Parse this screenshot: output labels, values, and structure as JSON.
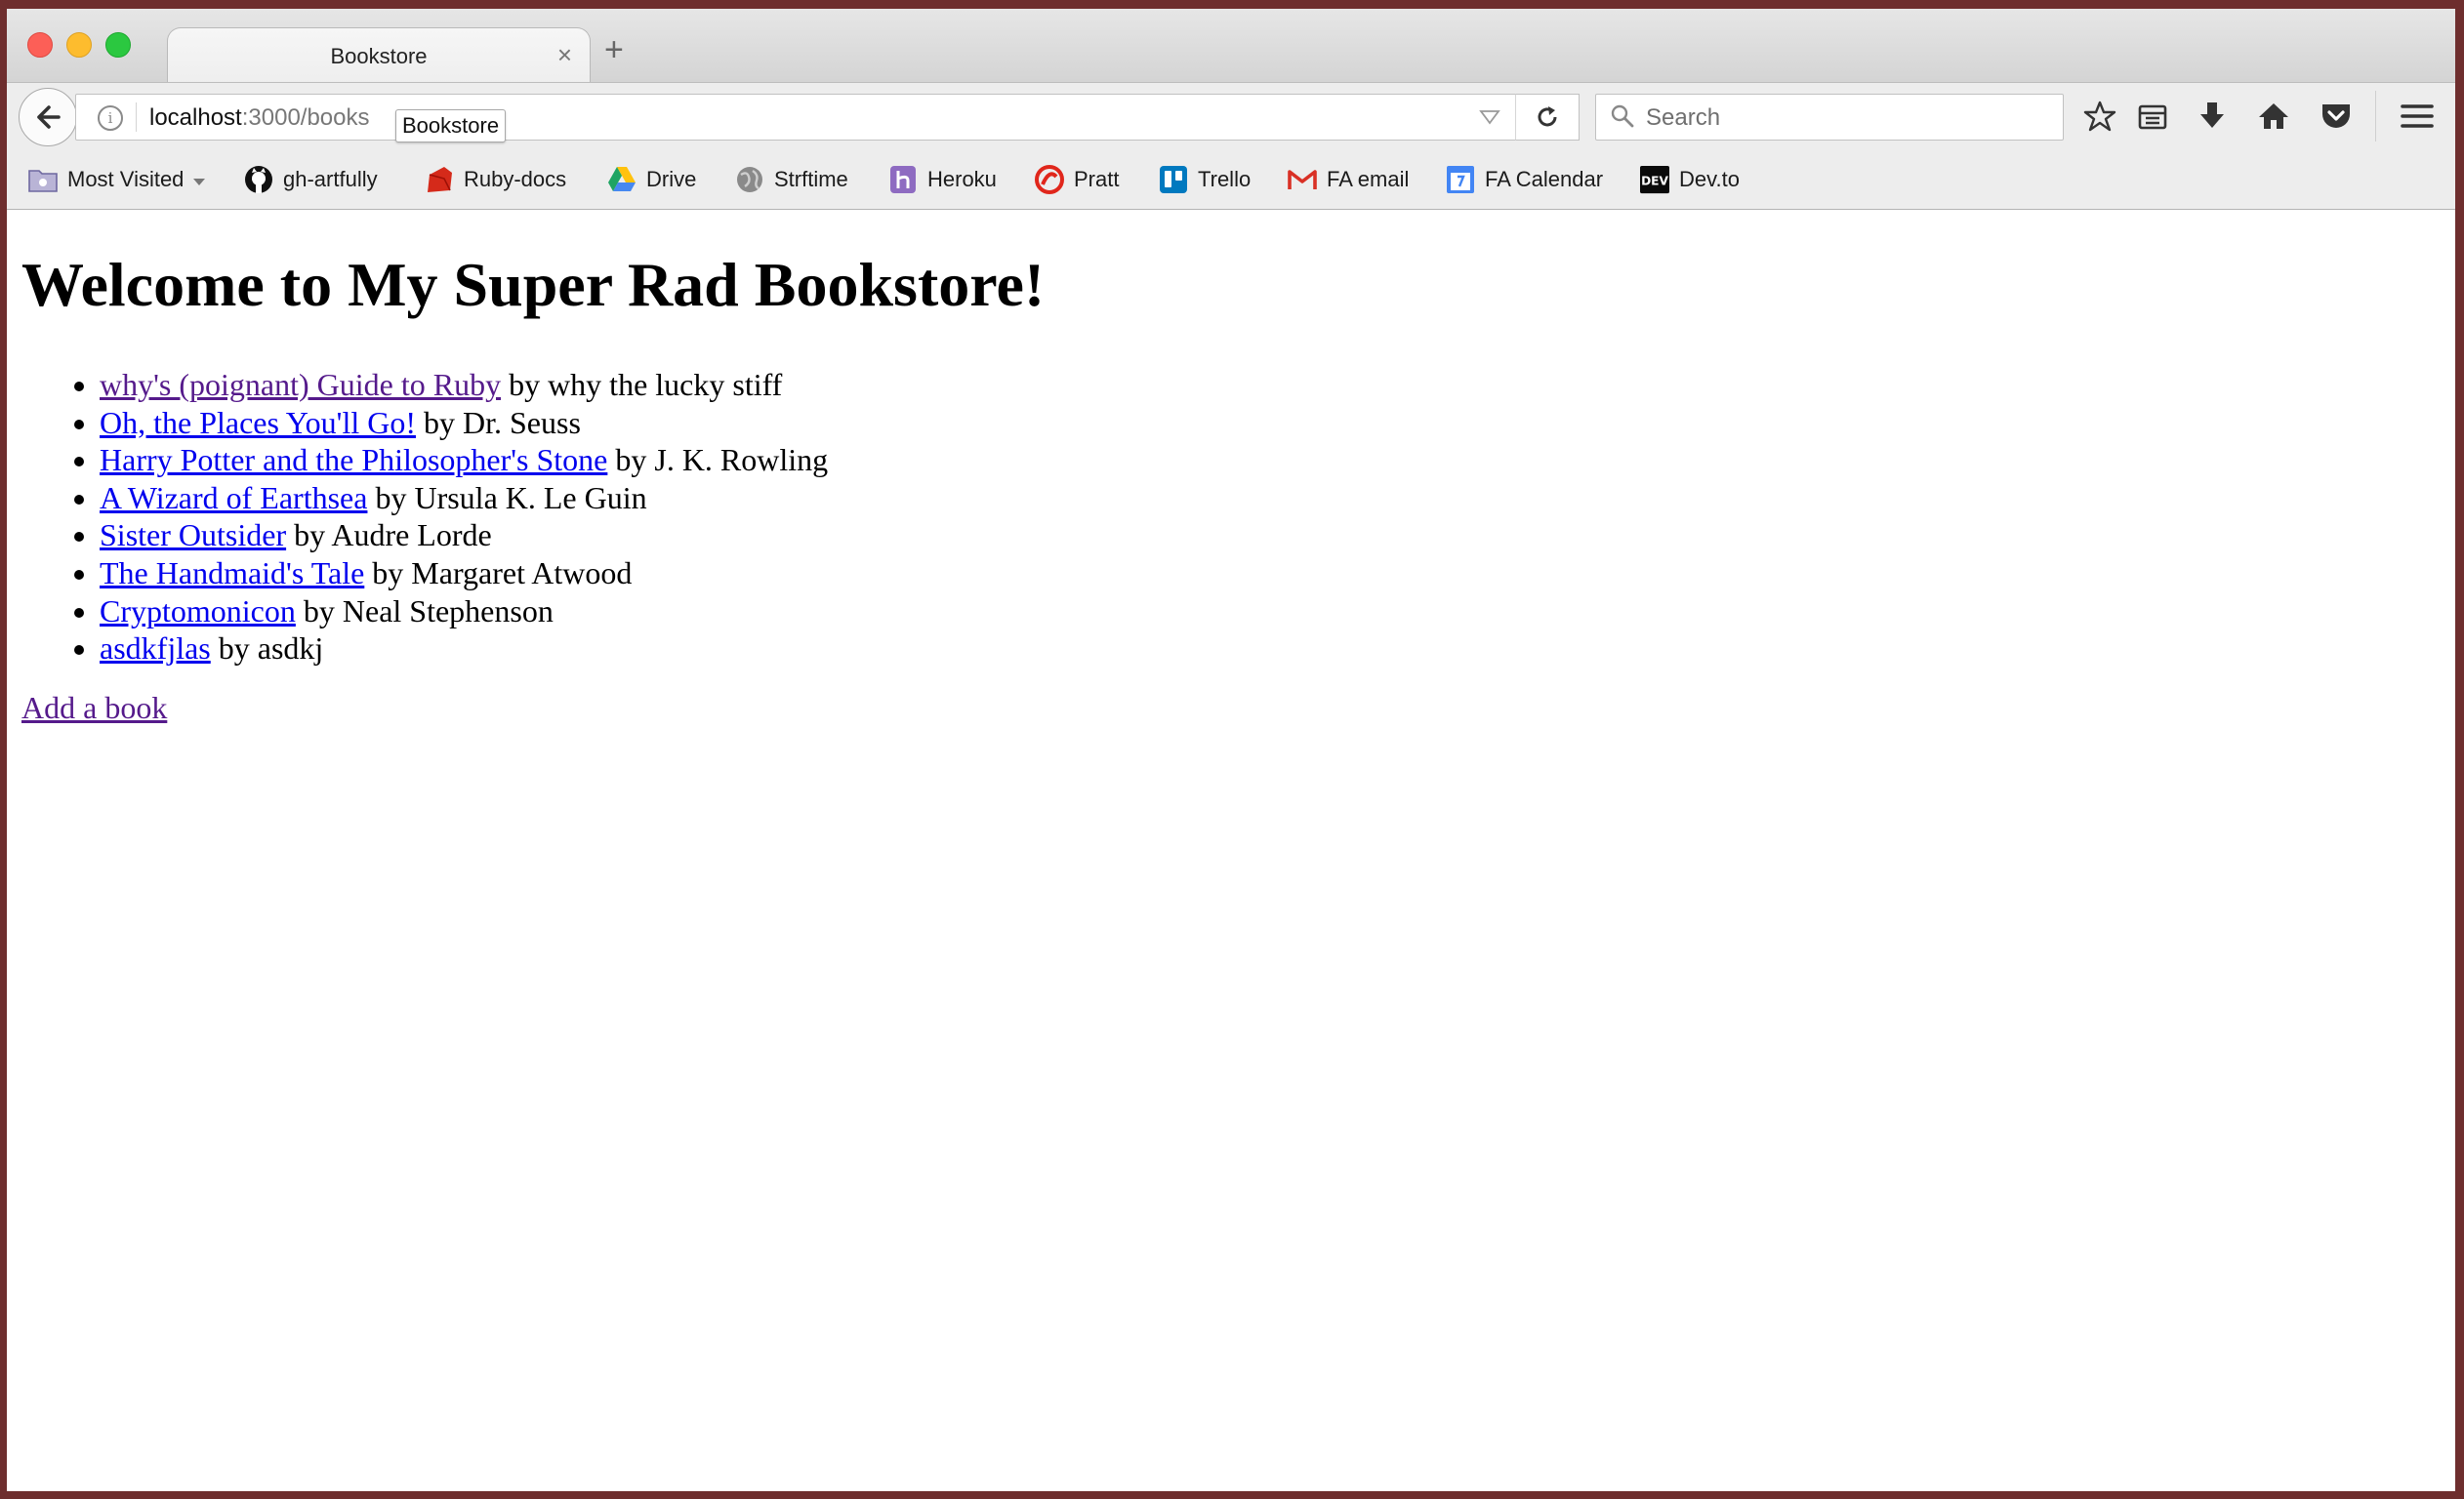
{
  "browser": {
    "tab_title": "Bookstore",
    "close_glyph": "×",
    "new_tab_glyph": "+",
    "url_host": "localhost",
    "url_rest": ":3000/books",
    "tooltip": "Bookstore",
    "search_placeholder": "Search"
  },
  "bookmarks": [
    {
      "label": "Most Visited",
      "icon": "folder-icon"
    },
    {
      "label": "gh-artfully",
      "icon": "github-icon"
    },
    {
      "label": "Ruby-docs",
      "icon": "ruby-icon"
    },
    {
      "label": "Drive",
      "icon": "drive-icon"
    },
    {
      "label": "Strftime",
      "icon": "globe-icon"
    },
    {
      "label": "Heroku",
      "icon": "heroku-icon"
    },
    {
      "label": "Pratt",
      "icon": "pratt-icon"
    },
    {
      "label": "Trello",
      "icon": "trello-icon"
    },
    {
      "label": "FA email",
      "icon": "gmail-icon"
    },
    {
      "label": "FA Calendar",
      "icon": "calendar-icon"
    },
    {
      "label": "Dev.to",
      "icon": "dev-icon"
    }
  ],
  "page": {
    "heading": "Welcome to My Super Rad Bookstore!",
    "books": [
      {
        "title": "why's (poignant) Guide to Ruby",
        "byline": " by why the lucky stiff",
        "visited": true
      },
      {
        "title": "Oh, the Places You'll Go!",
        "byline": " by Dr. Seuss",
        "visited": false
      },
      {
        "title": "Harry Potter and the Philosopher's Stone",
        "byline": " by J. K. Rowling",
        "visited": false
      },
      {
        "title": "A Wizard of Earthsea",
        "byline": " by Ursula K. Le Guin",
        "visited": false
      },
      {
        "title": "Sister Outsider",
        "byline": " by Audre Lorde",
        "visited": false
      },
      {
        "title": "The Handmaid's Tale",
        "byline": " by Margaret Atwood",
        "visited": false
      },
      {
        "title": "Cryptomonicon",
        "byline": " by Neal Stephenson",
        "visited": false
      },
      {
        "title": "asdkfjlas",
        "byline": " by asdkj",
        "visited": false
      }
    ],
    "add_link": "Add a book"
  },
  "colors": {
    "link": "#0000ee",
    "visited_link": "#551a8b",
    "window_frame": "#6e2e2e"
  }
}
